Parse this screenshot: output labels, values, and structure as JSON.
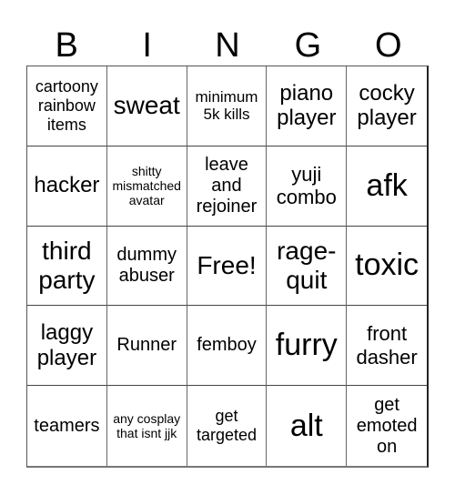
{
  "header": {
    "letters": [
      "B",
      "I",
      "N",
      "G",
      "O"
    ]
  },
  "cells": [
    "cartoony rainbow items",
    "sweat",
    "minimum 5k kills",
    "piano player",
    "cocky player",
    "hacker",
    "shitty mismatched avatar",
    "leave and rejoiner",
    "yuji combo",
    "afk",
    "third party",
    "dummy abuser",
    "Free!",
    "rage-quit",
    "toxic",
    "laggy player",
    "Runner",
    "femboy",
    "furry",
    "front dasher",
    "teamers",
    "any cosplay that isnt jjk",
    "get targeted",
    "alt",
    "get emoted on"
  ]
}
